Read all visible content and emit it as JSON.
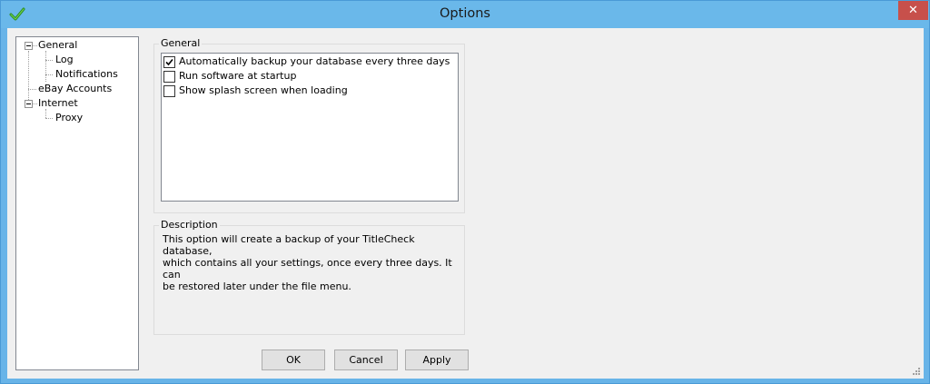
{
  "window": {
    "title": "Options",
    "close_label": "✕",
    "accent": "#68b4e8"
  },
  "tree": {
    "items": [
      {
        "label": "General",
        "expanded": true
      },
      {
        "label": "Log"
      },
      {
        "label": "Notifications"
      },
      {
        "label": "eBay Accounts"
      },
      {
        "label": "Internet",
        "expanded": true
      },
      {
        "label": "Proxy"
      }
    ]
  },
  "general": {
    "group_label": "General",
    "options": [
      {
        "label": "Automatically backup your database every three days",
        "checked": true
      },
      {
        "label": "Run software at startup",
        "checked": false
      },
      {
        "label": "Show splash screen when loading",
        "checked": false
      }
    ]
  },
  "description": {
    "group_label": "Description",
    "lines": [
      "This option will create a backup of your TitleCheck database,",
      "which contains all your settings, once every three days.  It can",
      "be restored later under the file menu."
    ]
  },
  "buttons": {
    "ok": "OK",
    "cancel": "Cancel",
    "apply": "Apply"
  }
}
